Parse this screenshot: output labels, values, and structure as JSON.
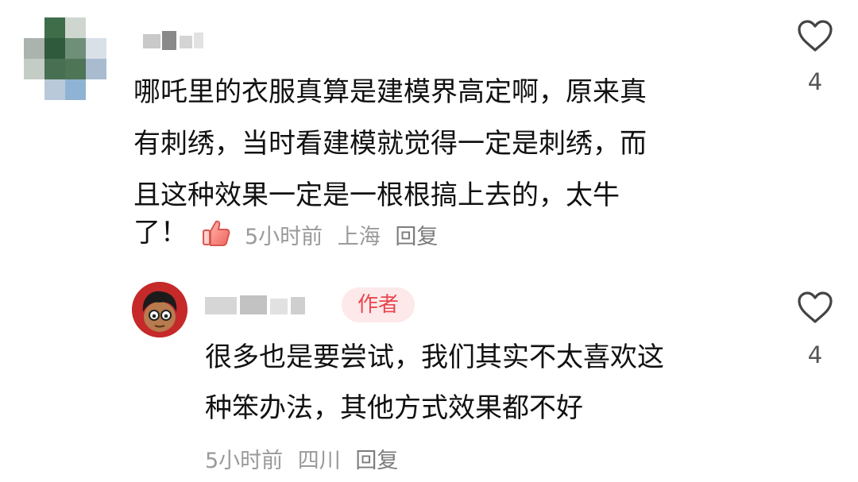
{
  "comment": {
    "text_lines": [
      "哪吒里的衣服真算是建模界高定啊，原来真",
      "有刺绣，当时看建模就觉得一定是刺绣，而",
      "且这种效果一定是一根根搞上去的，太牛"
    ],
    "text_tail": "了！",
    "time": "5小时前",
    "location": "上海",
    "reply_label": "回复",
    "like_count": "4",
    "icons": {
      "like": "heart-outline-icon",
      "reaction": "thumbs-up-sticker-icon"
    }
  },
  "reply": {
    "badge": "作者",
    "text_lines": [
      "很多也是要尝试，我们其实不太喜欢这",
      "种笨办法，其他方式效果都不好"
    ],
    "time": "5小时前",
    "location": "四川",
    "reply_label": "回复",
    "like_count": "4",
    "icons": {
      "like": "heart-outline-icon"
    }
  },
  "colors": {
    "badge_bg": "#fde9ea",
    "badge_text": "#e8474f",
    "meta_text": "#9a9a9a",
    "body_text": "#111111"
  }
}
